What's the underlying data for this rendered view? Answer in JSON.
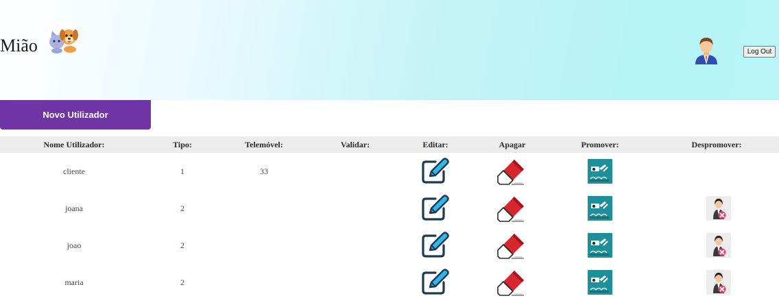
{
  "header": {
    "brand": "Mião",
    "logo_icon": "cat-dog-logo-icon",
    "avatar_icon": "user-avatar-icon",
    "logout_label": "Log Out",
    "gradient_colors": [
      "#ffffff",
      "#b6f3f7"
    ]
  },
  "toolbar": {
    "new_user_label": "Novo Utilizador",
    "accent_color": "#6f35a4"
  },
  "table": {
    "headers": [
      "Nome Utilizador:",
      "Tipo:",
      "Telemóvel:",
      "Validar:",
      "Editar:",
      "Apagar",
      "Promover:",
      "Despromover:"
    ],
    "rows": [
      {
        "name": "cliente",
        "type": "1",
        "phone": "33",
        "validate": "",
        "demote": false
      },
      {
        "name": "joana",
        "type": "2",
        "phone": "",
        "validate": "",
        "demote": true
      },
      {
        "name": "joao",
        "type": "2",
        "phone": "",
        "validate": "",
        "demote": true
      },
      {
        "name": "maria",
        "type": "2",
        "phone": "",
        "validate": "",
        "demote": true
      }
    ],
    "icons": {
      "edit": "edit-pencil-icon",
      "delete": "eraser-icon",
      "promote": "promote-icon",
      "demote": "demote-user-icon"
    }
  }
}
